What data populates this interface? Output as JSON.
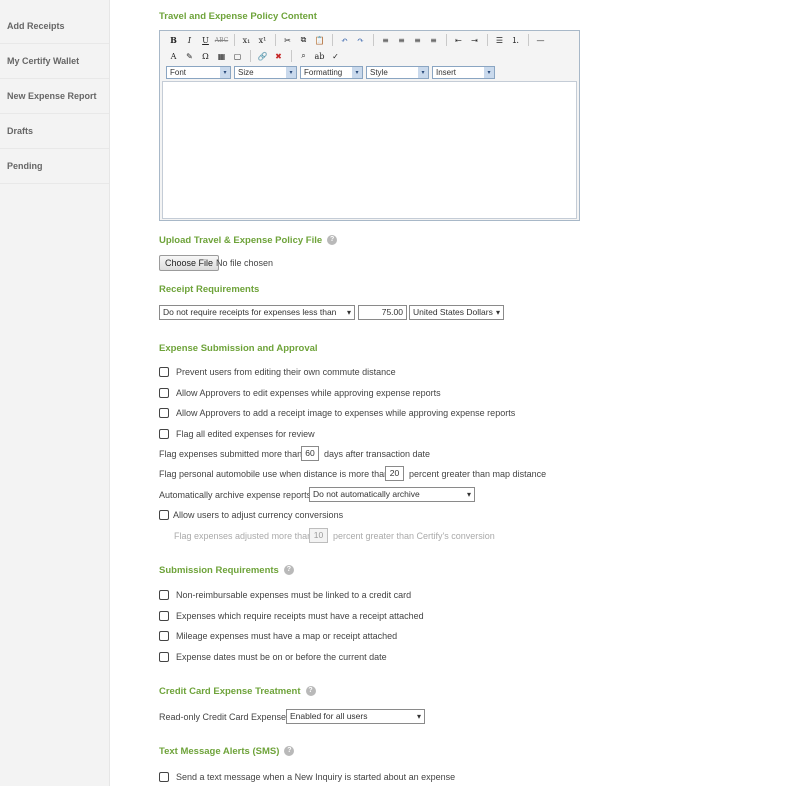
{
  "sidebar": {
    "items": [
      {
        "label": "Add Receipts"
      },
      {
        "label": "My Certify Wallet"
      },
      {
        "label": "New Expense Report"
      },
      {
        "label": "Drafts"
      },
      {
        "label": "Pending"
      }
    ]
  },
  "policy_content": {
    "title": "Travel and Expense Policy Content",
    "toolbar_row1": [
      {
        "icon": "bold-icon",
        "glyph": "B"
      },
      {
        "icon": "italic-icon",
        "glyph": "I"
      },
      {
        "icon": "underline-icon",
        "glyph": "U"
      },
      {
        "icon": "strikethrough-icon",
        "glyph": "ABC"
      },
      {
        "icon": "subscript-icon",
        "glyph": "x₁"
      },
      {
        "icon": "superscript-icon",
        "glyph": "x¹"
      },
      {
        "icon": "cut-icon",
        "glyph": "✂"
      },
      {
        "icon": "copy-icon",
        "glyph": "⧉"
      },
      {
        "icon": "paste-icon",
        "glyph": "📋"
      },
      {
        "icon": "undo-icon",
        "glyph": "↶"
      },
      {
        "icon": "redo-icon",
        "glyph": "↷"
      },
      {
        "icon": "align-left-icon",
        "glyph": "≡"
      },
      {
        "icon": "align-center-icon",
        "glyph": "≡"
      },
      {
        "icon": "align-right-icon",
        "glyph": "≡"
      },
      {
        "icon": "align-justify-icon",
        "glyph": "≡"
      },
      {
        "icon": "outdent-icon",
        "glyph": "⇤"
      },
      {
        "icon": "indent-icon",
        "glyph": "⇥"
      },
      {
        "icon": "bullet-list-icon",
        "glyph": "☰"
      },
      {
        "icon": "numbered-list-icon",
        "glyph": "⒈"
      },
      {
        "icon": "horizontal-rule-icon",
        "glyph": "—"
      }
    ],
    "toolbar_row2": [
      {
        "icon": "font-color-icon",
        "glyph": "A"
      },
      {
        "icon": "highlight-icon",
        "glyph": "✎"
      },
      {
        "icon": "special-char-icon",
        "glyph": "Ω"
      },
      {
        "icon": "insert-table-icon",
        "glyph": "▦"
      },
      {
        "icon": "insert-box-icon",
        "glyph": "▢"
      },
      {
        "icon": "insert-link-icon",
        "glyph": "🔗"
      },
      {
        "icon": "remove-link-icon",
        "glyph": "✖"
      },
      {
        "icon": "find-icon",
        "glyph": "⌕"
      },
      {
        "icon": "replace-icon",
        "glyph": "ab"
      },
      {
        "icon": "spellcheck-icon",
        "glyph": "✓"
      }
    ],
    "dropdowns": [
      {
        "label": "Font"
      },
      {
        "label": "Size"
      },
      {
        "label": "Formatting"
      },
      {
        "label": "Style"
      },
      {
        "label": "Insert"
      }
    ]
  },
  "upload": {
    "title": "Upload Travel & Expense Policy File",
    "button": "Choose File",
    "status": "No file chosen"
  },
  "receipts": {
    "title": "Receipt Requirements",
    "rule": "Do not require receipts for expenses less than",
    "amount": "75.00",
    "currency": "United States Dollars"
  },
  "submission_approval": {
    "title": "Expense Submission and Approval",
    "checks": [
      {
        "label": "Prevent users from editing their own commute distance"
      },
      {
        "label": "Allow Approvers to edit expenses while approving expense reports"
      },
      {
        "label": "Allow Approvers to add a receipt image to expenses while approving expense reports"
      },
      {
        "label": "Flag all edited expenses for review"
      }
    ],
    "flag_days_prefix": "Flag expenses submitted more than",
    "flag_days_value": "60",
    "flag_days_suffix": "days after transaction date",
    "flag_auto_prefix": "Flag personal automobile use when distance is more than",
    "flag_auto_value": "20",
    "flag_auto_suffix": "percent greater than map distance",
    "archive_label": "Automatically archive expense reports",
    "archive_value": "Do not automatically archive",
    "currency_conv_label": "Allow users to adjust currency conversions",
    "currency_flag_prefix": "Flag expenses adjusted more than",
    "currency_flag_value": "10",
    "currency_flag_suffix": "percent greater than Certify's conversion"
  },
  "submission_requirements": {
    "title": "Submission Requirements",
    "checks": [
      {
        "label": "Non-reimbursable expenses must be linked to a credit card"
      },
      {
        "label": "Expenses which require receipts must have a receipt attached"
      },
      {
        "label": "Mileage expenses must have a map or receipt attached"
      },
      {
        "label": "Expense dates must be on or before the current date"
      }
    ]
  },
  "credit_card": {
    "title": "Credit Card Expense Treatment",
    "label": "Read-only Credit Card Expenses",
    "value": "Enabled for all users"
  },
  "sms": {
    "title": "Text Message Alerts (SMS)",
    "check": "Send a text message when a New Inquiry is started about an expense"
  },
  "help_glyph": "?",
  "caret_glyph": "▾",
  "colors": {
    "accent": "#6ea33a",
    "sidebar_bg": "#f3f3f3"
  }
}
